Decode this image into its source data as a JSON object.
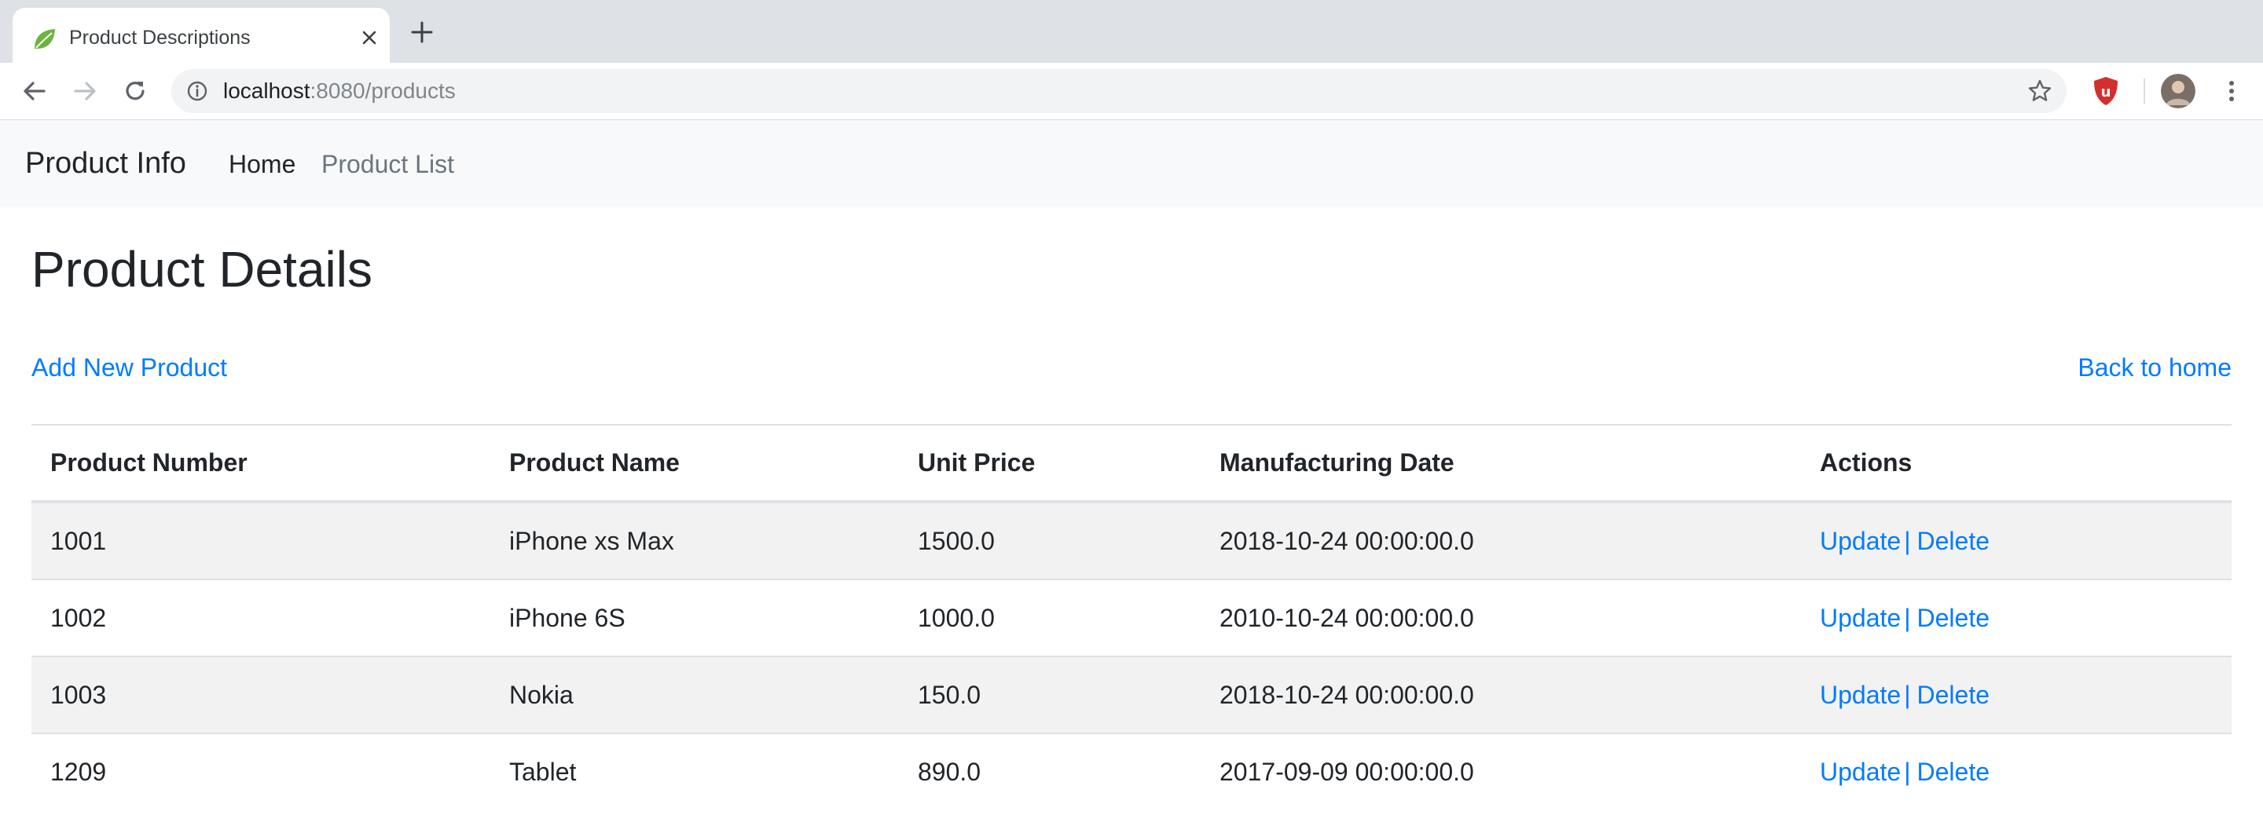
{
  "browser": {
    "tab_title": "Product Descriptions",
    "url_host": "localhost",
    "url_rest": ":8080/products",
    "icons": {
      "favicon": "spring-leaf-icon",
      "close": "close-icon",
      "new_tab": "plus-icon",
      "back": "arrow-left-icon",
      "forward": "arrow-right-icon",
      "reload": "reload-icon",
      "info": "info-icon",
      "bookmark": "star-icon",
      "extension": "ublock-icon",
      "profile": "avatar",
      "menu": "more-vertical-icon"
    }
  },
  "navbar": {
    "brand": "Product Info",
    "links": [
      {
        "label": "Home"
      },
      {
        "label": "Product List"
      }
    ]
  },
  "page": {
    "title": "Product Details",
    "add_link": "Add New Product",
    "back_link": "Back to home"
  },
  "table": {
    "headers": [
      "Product Number",
      "Product Name",
      "Unit Price",
      "Manufacturing Date",
      "Actions"
    ],
    "rows": [
      {
        "number": "1001",
        "name": "iPhone xs Max",
        "price": "1500.0",
        "date": "2018-10-24 00:00:00.0",
        "update": "Update",
        "separator": "|",
        "delete": "Delete"
      },
      {
        "number": "1002",
        "name": "iPhone 6S",
        "price": "1000.0",
        "date": "2010-10-24 00:00:00.0",
        "update": "Update",
        "separator": "|",
        "delete": "Delete"
      },
      {
        "number": "1003",
        "name": "Nokia",
        "price": "150.0",
        "date": "2018-10-24 00:00:00.0",
        "update": "Update",
        "separator": "|",
        "delete": "Delete"
      },
      {
        "number": "1209",
        "name": "Tablet",
        "price": "890.0",
        "date": "2017-09-09 00:00:00.0",
        "update": "Update",
        "separator": "|",
        "delete": "Delete"
      }
    ]
  },
  "colors": {
    "link": "#007bff",
    "navbar_bg": "#f8f9fa",
    "stripe": "#f2f2f2",
    "text": "#212529",
    "muted": "#6c757d"
  }
}
